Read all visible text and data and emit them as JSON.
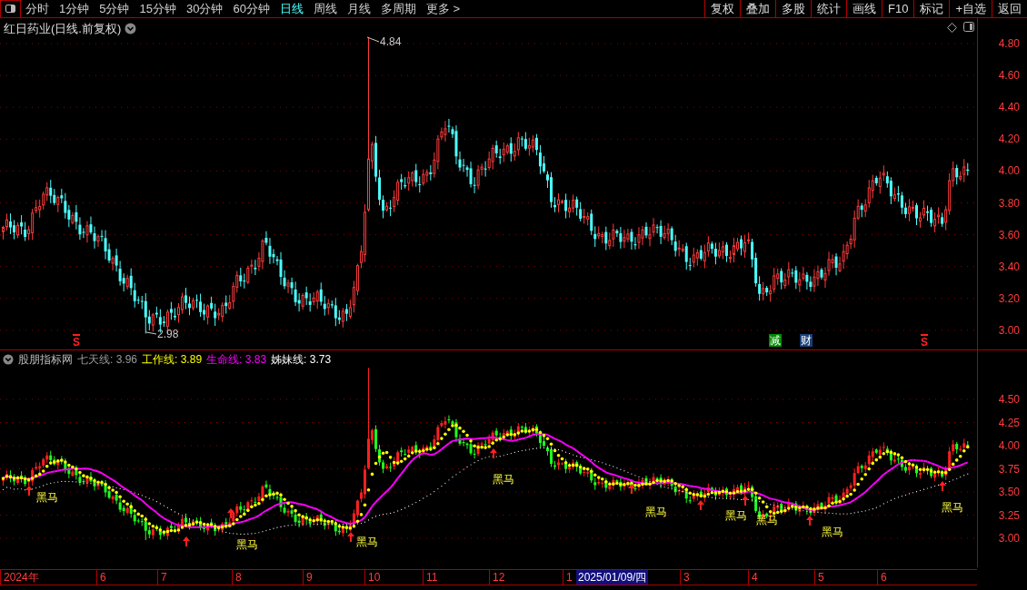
{
  "toolbar": {
    "periods": [
      {
        "label": "分时",
        "selected": false
      },
      {
        "label": "1分钟",
        "selected": false
      },
      {
        "label": "5分钟",
        "selected": false
      },
      {
        "label": "15分钟",
        "selected": false
      },
      {
        "label": "30分钟",
        "selected": false
      },
      {
        "label": "60分钟",
        "selected": false
      },
      {
        "label": "日线",
        "selected": true
      },
      {
        "label": "周线",
        "selected": false
      },
      {
        "label": "月线",
        "selected": false
      },
      {
        "label": "多周期",
        "selected": false
      },
      {
        "label": "更多 >",
        "selected": false
      }
    ],
    "buttons": [
      "复权",
      "叠加",
      "多股",
      "统计",
      "画线",
      "F10",
      "标记",
      "+自选",
      "返回"
    ]
  },
  "main_chart": {
    "title": "红日药业(日线.前复权)",
    "high_label": "4.84",
    "low_label": "2.98",
    "price_axis": [
      "4.80",
      "4.60",
      "4.40",
      "4.20",
      "4.00",
      "3.80",
      "3.60",
      "3.40",
      "3.20",
      "3.00"
    ],
    "markers": [
      {
        "kind": "sell",
        "text": "S"
      },
      {
        "kind": "reduce",
        "text": "减"
      },
      {
        "kind": "finance",
        "text": "财"
      },
      {
        "kind": "sell",
        "text": "S"
      }
    ]
  },
  "indicator": {
    "name": "股朋指标网",
    "legend": [
      {
        "text": "七天线: 3.96",
        "color": "#9a9a9a"
      },
      {
        "text": "工作线: 3.89",
        "color": "#ffff00"
      },
      {
        "text": "生命线: 3.83",
        "color": "#ff00ff"
      },
      {
        "text": "姊妹线: 3.73",
        "color": "#ffffff"
      }
    ],
    "axis": [
      "4.50",
      "4.25",
      "4.00",
      "3.75",
      "3.50",
      "3.25",
      "3.00"
    ],
    "signals": [
      {
        "label": "黑马"
      },
      {
        "label": "黑马"
      },
      {
        "label": "黑马"
      },
      {
        "label": "黑马"
      },
      {
        "label": "黑马"
      },
      {
        "label": "黑马"
      },
      {
        "label": "黑马"
      },
      {
        "label": "黑马"
      },
      {
        "label": "黑马"
      }
    ]
  },
  "date_axis": [
    {
      "label": "2024年",
      "selected": false
    },
    {
      "label": "6",
      "selected": false
    },
    {
      "label": "7",
      "selected": false
    },
    {
      "label": "8",
      "selected": false
    },
    {
      "label": "9",
      "selected": false
    },
    {
      "label": "10",
      "selected": false
    },
    {
      "label": "11",
      "selected": false
    },
    {
      "label": "12",
      "selected": false
    },
    {
      "label": "1",
      "selected": false
    },
    {
      "label": "2025/01/09/四",
      "selected": true
    },
    {
      "label": "3",
      "selected": false
    },
    {
      "label": "4",
      "selected": false
    },
    {
      "label": "5",
      "selected": false
    },
    {
      "label": "6",
      "selected": false
    }
  ]
}
